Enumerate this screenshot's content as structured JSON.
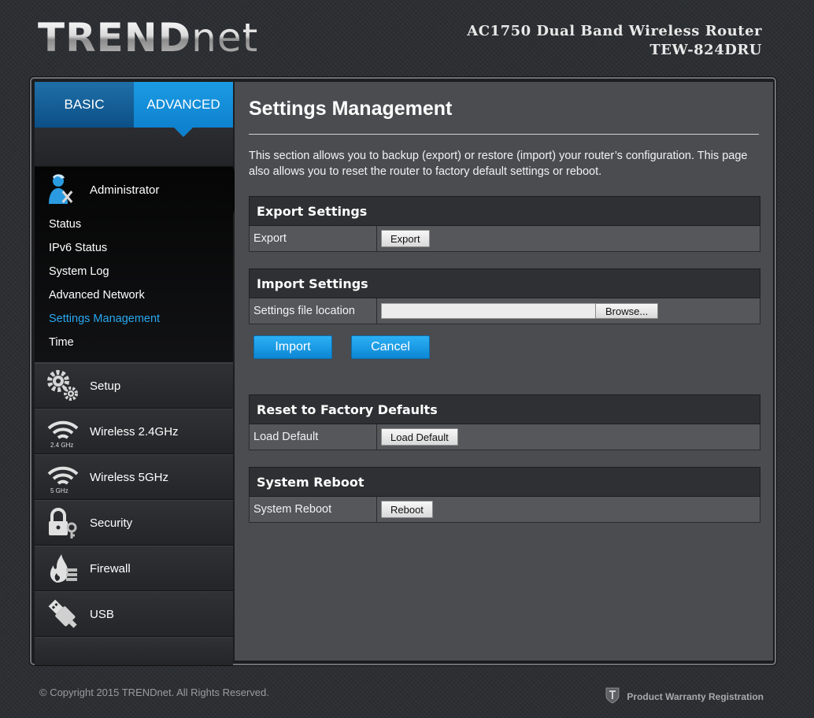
{
  "header": {
    "logo_part1": "TREND",
    "logo_part2": "net",
    "product_name": "AC1750 Dual Band Wireless Router",
    "model": "TEW-824DRU"
  },
  "tabs": [
    {
      "label": "BASIC",
      "active": false
    },
    {
      "label": "ADVANCED",
      "active": true
    }
  ],
  "sidebar": {
    "administrator": {
      "label": "Administrator",
      "icon": "administrator-icon",
      "items": [
        {
          "label": "Status"
        },
        {
          "label": "IPv6 Status"
        },
        {
          "label": "System Log"
        },
        {
          "label": "Advanced Network"
        },
        {
          "label": "Settings Management",
          "active": true
        },
        {
          "label": "Time"
        }
      ]
    },
    "nav": [
      {
        "label": "Setup",
        "icon": "gears-icon"
      },
      {
        "label": "Wireless 2.4GHz",
        "icon": "wifi-icon",
        "band": "2.4 GHz"
      },
      {
        "label": "Wireless 5GHz",
        "icon": "wifi-icon",
        "band": "5 GHz"
      },
      {
        "label": "Security",
        "icon": "lock-key-icon"
      },
      {
        "label": "Firewall",
        "icon": "firewall-icon"
      },
      {
        "label": "USB",
        "icon": "usb-icon"
      }
    ]
  },
  "main": {
    "title": "Settings Management",
    "description": "This section allows you to backup (export) or restore (import) your router’s configuration. This page also allows you to reset the router to factory default settings or reboot.",
    "export": {
      "heading": "Export Settings",
      "label": "Export",
      "button": "Export"
    },
    "import": {
      "heading": "Import Settings",
      "label": "Settings file location",
      "file_value": "",
      "browse": "Browse...",
      "import_button": "Import",
      "cancel_button": "Cancel"
    },
    "reset": {
      "heading": "Reset to Factory Defaults",
      "label": "Load Default",
      "button": "Load Default"
    },
    "reboot": {
      "heading": "System Reboot",
      "label": "System Reboot",
      "button": "Reboot"
    }
  },
  "footer": {
    "copyright": "© Copyright 2015 TRENDnet. All Rights Reserved.",
    "warranty": "Product Warranty Registration"
  },
  "colors": {
    "accent": "#1b9be3",
    "active_link": "#29a8f0"
  }
}
